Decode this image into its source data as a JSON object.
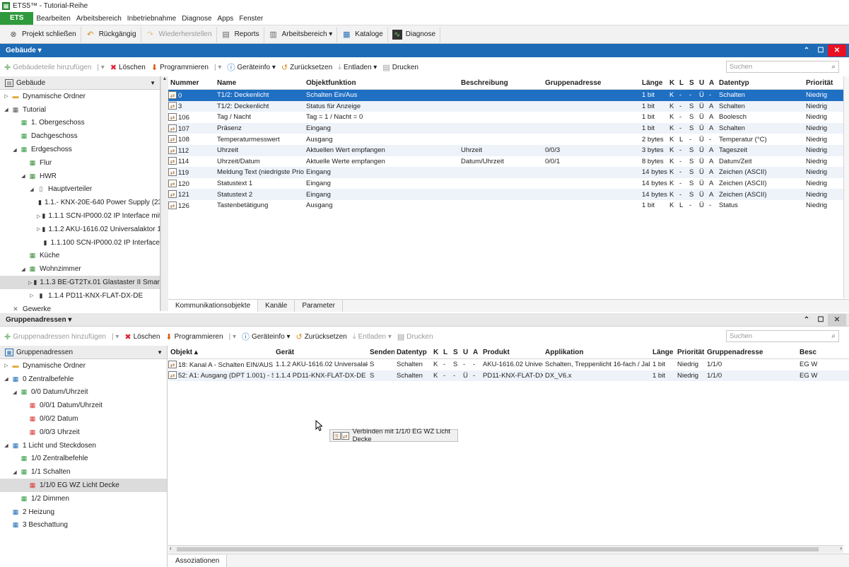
{
  "app": {
    "title": "ETS5™ - Tutorial-Reihe"
  },
  "menu": {
    "ets": "ETS",
    "items": [
      "Bearbeiten",
      "Arbeitsbereich",
      "Inbetriebnahme",
      "Diagnose",
      "Apps",
      "Fenster"
    ]
  },
  "toolbar": {
    "close_project": "Projekt schließen",
    "undo": "Rückgängig",
    "redo": "Wiederherstellen",
    "reports": "Reports",
    "workspace": "Arbeitsbereich ▾",
    "catalogs": "Kataloge",
    "diagnose": "Diagnose"
  },
  "top": {
    "panel_title": "Gebäude ▾",
    "actions": {
      "add": "Gebäudeteile hinzufügen",
      "delete": "Löschen",
      "program": "Programmieren",
      "deviceinfo": "Geräteinfo ▾",
      "reset": "Zurücksetzen",
      "unload": "Entladen ▾",
      "print": "Drucken"
    },
    "search_placeholder": "Suchen",
    "tree_header": "Gebäude",
    "tree": [
      {
        "label": "Dynamische Ordner",
        "icon": "folder-icon",
        "indent": 0,
        "tw": "▷"
      },
      {
        "label": "Tutorial",
        "icon": "building-icon",
        "indent": 0,
        "tw": "◢"
      },
      {
        "label": "1. Obergeschoss",
        "icon": "floor-icon",
        "indent": 1,
        "tw": ""
      },
      {
        "label": "Dachgeschoss",
        "icon": "floor-icon",
        "indent": 1,
        "tw": ""
      },
      {
        "label": "Erdgeschoss",
        "icon": "floor-icon",
        "indent": 1,
        "tw": "◢"
      },
      {
        "label": "Flur",
        "icon": "room-icon",
        "indent": 2,
        "tw": ""
      },
      {
        "label": "HWR",
        "icon": "room-icon",
        "indent": 2,
        "tw": "◢"
      },
      {
        "label": "Hauptverteiler",
        "icon": "cabinet-icon",
        "indent": 3,
        "tw": "◢"
      },
      {
        "label": "1.1.- KNX-20E-640 Power Supply (230...",
        "icon": "device-icon",
        "indent": 4,
        "tw": ""
      },
      {
        "label": "1.1.1 SCN-IP000.02 IP Interface mit E...",
        "icon": "device-icon",
        "indent": 4,
        "tw": "▷"
      },
      {
        "label": "1.1.2 AKU-1616.02 Universalaktor 16-f...",
        "icon": "device-icon",
        "indent": 4,
        "tw": "▷"
      },
      {
        "label": "1.1.100 SCN-IP000.02 IP Interface",
        "icon": "device-icon",
        "indent": 4,
        "tw": ""
      },
      {
        "label": "Küche",
        "icon": "room-icon",
        "indent": 2,
        "tw": ""
      },
      {
        "label": "Wohnzimmer",
        "icon": "room-icon",
        "indent": 2,
        "tw": "◢"
      },
      {
        "label": "1.1.3 BE-GT2Tx.01 Glastaster II Smart mi...",
        "icon": "device-icon",
        "indent": 3,
        "tw": "▷",
        "selected": true
      },
      {
        "label": "1.1.4 PD11-KNX-FLAT-DX-DE",
        "icon": "device-icon",
        "indent": 3,
        "tw": "▷"
      },
      {
        "label": "Gewerke",
        "icon": "trades-icon",
        "indent": 0,
        "tw": ""
      }
    ],
    "grid_headers": [
      "Nummer",
      "Name",
      "Objektfunktion",
      "Beschreibung",
      "Gruppenadresse",
      "Länge",
      "K",
      "L",
      "S",
      "Ü",
      "A",
      "Datentyp",
      "Priorität"
    ],
    "rows": [
      [
        "0",
        "T1/2: Deckenlicht",
        "Schalten Ein/Aus",
        "",
        "",
        "1 bit",
        "K",
        "-",
        "-",
        "Ü",
        "-",
        "Schalten",
        "Niedrig"
      ],
      [
        "3",
        "T1/2: Deckenlicht",
        "Status für Anzeige",
        "",
        "",
        "1 bit",
        "K",
        "-",
        "S",
        "Ü",
        "A",
        "Schalten",
        "Niedrig"
      ],
      [
        "106",
        "Tag / Nacht",
        "Tag = 1 / Nacht = 0",
        "",
        "",
        "1 bit",
        "K",
        "-",
        "S",
        "Ü",
        "A",
        "Boolesch",
        "Niedrig"
      ],
      [
        "107",
        "Präsenz",
        "Eingang",
        "",
        "",
        "1 bit",
        "K",
        "-",
        "S",
        "Ü",
        "A",
        "Schalten",
        "Niedrig"
      ],
      [
        "108",
        "Temperaturmesswert",
        "Ausgang",
        "",
        "",
        "2 bytes",
        "K",
        "L",
        "-",
        "Ü",
        "-",
        "Temperatur (°C)",
        "Niedrig"
      ],
      [
        "112",
        "Uhrzeit",
        "Aktuellen Wert empfangen",
        "Uhrzeit",
        "0/0/3",
        "3 bytes",
        "K",
        "-",
        "S",
        "Ü",
        "A",
        "Tageszeit",
        "Niedrig"
      ],
      [
        "114",
        "Uhrzeit/Datum",
        "Aktuelle Werte empfangen",
        "Datum/Uhrzeit",
        "0/0/1",
        "8 bytes",
        "K",
        "-",
        "S",
        "Ü",
        "A",
        "Datum/Zeit",
        "Niedrig"
      ],
      [
        "119",
        "Meldung Text (niedrigste Prio...",
        "Eingang",
        "",
        "",
        "14 bytes",
        "K",
        "-",
        "S",
        "Ü",
        "A",
        "Zeichen (ASCII)",
        "Niedrig"
      ],
      [
        "120",
        "Statustext 1",
        "Eingang",
        "",
        "",
        "14 bytes",
        "K",
        "-",
        "S",
        "Ü",
        "A",
        "Zeichen (ASCII)",
        "Niedrig"
      ],
      [
        "121",
        "Statustext 2",
        "Eingang",
        "",
        "",
        "14 bytes",
        "K",
        "-",
        "S",
        "Ü",
        "A",
        "Zeichen (ASCII)",
        "Niedrig"
      ],
      [
        "126",
        "Tastenbetätigung",
        "Ausgang",
        "",
        "",
        "1 bit",
        "K",
        "L",
        "-",
        "Ü",
        "-",
        "Status",
        "Niedrig"
      ]
    ],
    "tabs": [
      "Kommunikationsobjekte",
      "Kanäle",
      "Parameter"
    ]
  },
  "bottom": {
    "panel_title": "Gruppenadressen ▾",
    "actions": {
      "add": "Gruppenadressen hinzufügen",
      "delete": "Löschen",
      "program": "Programmieren",
      "deviceinfo": "Geräteinfo ▾",
      "reset": "Zurücksetzen",
      "unload": "Entladen ▾",
      "print": "Drucken"
    },
    "search_placeholder": "Suchen",
    "tree_header": "Gruppenadressen",
    "tree": [
      {
        "label": "Dynamische Ordner",
        "icon": "folder-icon",
        "indent": 0,
        "tw": "▷",
        "color": ""
      },
      {
        "label": "0 Zentralbefehle",
        "icon": "main-group-icon",
        "indent": 0,
        "tw": "◢",
        "color": "blue"
      },
      {
        "label": "0/0 Datum/Uhrzeit",
        "icon": "middle-group-icon",
        "indent": 1,
        "tw": "◢",
        "color": "green"
      },
      {
        "label": "0/0/1 Datum/Uhrzeit",
        "icon": "group-address-icon",
        "indent": 2,
        "tw": "",
        "color": "red"
      },
      {
        "label": "0/0/2 Datum",
        "icon": "group-address-icon",
        "indent": 2,
        "tw": "",
        "color": "red"
      },
      {
        "label": "0/0/3 Uhrzeit",
        "icon": "group-address-icon",
        "indent": 2,
        "tw": "",
        "color": "red"
      },
      {
        "label": "1 Licht und Steckdosen",
        "icon": "main-group-icon",
        "indent": 0,
        "tw": "◢",
        "color": "blue"
      },
      {
        "label": "1/0 Zentralbefehle",
        "icon": "middle-group-icon",
        "indent": 1,
        "tw": "",
        "color": "green"
      },
      {
        "label": "1/1 Schalten",
        "icon": "middle-group-icon",
        "indent": 1,
        "tw": "◢",
        "color": "green"
      },
      {
        "label": "1/1/0 EG WZ Licht Decke",
        "icon": "group-address-icon",
        "indent": 2,
        "tw": "",
        "color": "red",
        "selected": true
      },
      {
        "label": "1/2 Dimmen",
        "icon": "middle-group-icon",
        "indent": 1,
        "tw": "",
        "color": "green"
      },
      {
        "label": "2 Heizung",
        "icon": "main-group-icon",
        "indent": 0,
        "tw": "",
        "color": "blue"
      },
      {
        "label": "3 Beschattung",
        "icon": "main-group-icon",
        "indent": 0,
        "tw": "",
        "color": "blue"
      }
    ],
    "grid_headers": [
      "Objekt ▴",
      "Gerät",
      "Senden",
      "Datentyp",
      "K",
      "L",
      "S",
      "Ü",
      "A",
      "Produkt",
      "Applikation",
      "Länge",
      "Priorität",
      "Gruppenadresse",
      "Besc"
    ],
    "rows": [
      [
        "18: Kanal A - Schalten EIN/AUS",
        "1.1.2 AKU-1616.02 Universalakt...",
        "S",
        "Schalten",
        "K",
        "-",
        "S",
        "-",
        "-",
        "AKU-1616.02 Univer...",
        "Schalten, Treppenlicht 16-fach / Jalo...",
        "1 bit",
        "Niedrig",
        "1/1/0",
        "EG W"
      ],
      [
        "52: A1: Ausgang (DPT 1.001) - Schal...",
        "1.1.4 PD11-KNX-FLAT-DX-DE",
        "S",
        "Schalten",
        "K",
        "-",
        "-",
        "Ü",
        "-",
        "PD11-KNX-FLAT-DX...",
        "DX_V6.x",
        "1 bit",
        "Niedrig",
        "1/1/0",
        "EG W"
      ]
    ],
    "drag_tooltip": "Verbinden mit 1/1/0 EG WZ Licht Decke",
    "tabs": [
      "Assoziationen"
    ]
  },
  "colors": {
    "accent_blue": "#1d6ab5",
    "ets_green": "#2e9a3c",
    "selection": "#1f6fc3",
    "close_red": "#e81123"
  }
}
